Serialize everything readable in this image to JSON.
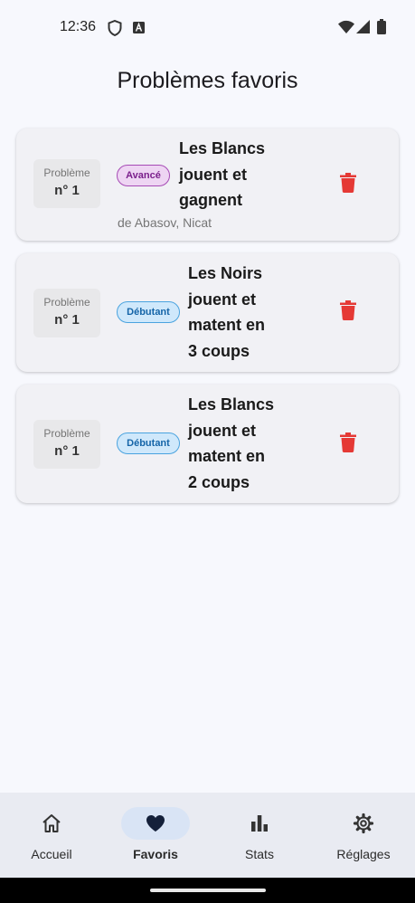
{
  "status_bar": {
    "time": "12:36",
    "icons": [
      "shield-icon",
      "font-a-icon",
      "wifi-icon",
      "signal-icon",
      "battery-icon"
    ]
  },
  "page": {
    "title": "Problèmes favoris"
  },
  "colors": {
    "background": "#f7f8fd",
    "card": "#f1f1f5",
    "delete": "#e53935",
    "advanced_badge": "#eed5f3",
    "beginner_badge": "#cfe8fb",
    "nav_active": "#d9e4f5"
  },
  "favorites": [
    {
      "number_label": "Problème",
      "number_value": "n° 1",
      "level": "Avancé",
      "title_lines": [
        "Les Blancs",
        "jouent et",
        "gagnent"
      ],
      "author": "de Abasov, Nicat"
    },
    {
      "number_label": "Problème",
      "number_value": "n° 1",
      "level": "Débutant",
      "title_lines": [
        "Les Noirs",
        "jouent et",
        "matent en",
        "3 coups"
      ]
    },
    {
      "number_label": "Problème",
      "number_value": "n° 1",
      "level": "Débutant",
      "title_lines": [
        "Les Blancs",
        "jouent et",
        "matent en",
        "2 coups"
      ]
    }
  ],
  "bottom_nav": {
    "items": [
      {
        "label": "Accueil",
        "icon": "home-icon",
        "active": false
      },
      {
        "label": "Favoris",
        "icon": "heart-icon",
        "active": true
      },
      {
        "label": "Stats",
        "icon": "bar-chart-icon",
        "active": false
      },
      {
        "label": "Réglages",
        "icon": "gear-icon",
        "active": false
      }
    ]
  }
}
